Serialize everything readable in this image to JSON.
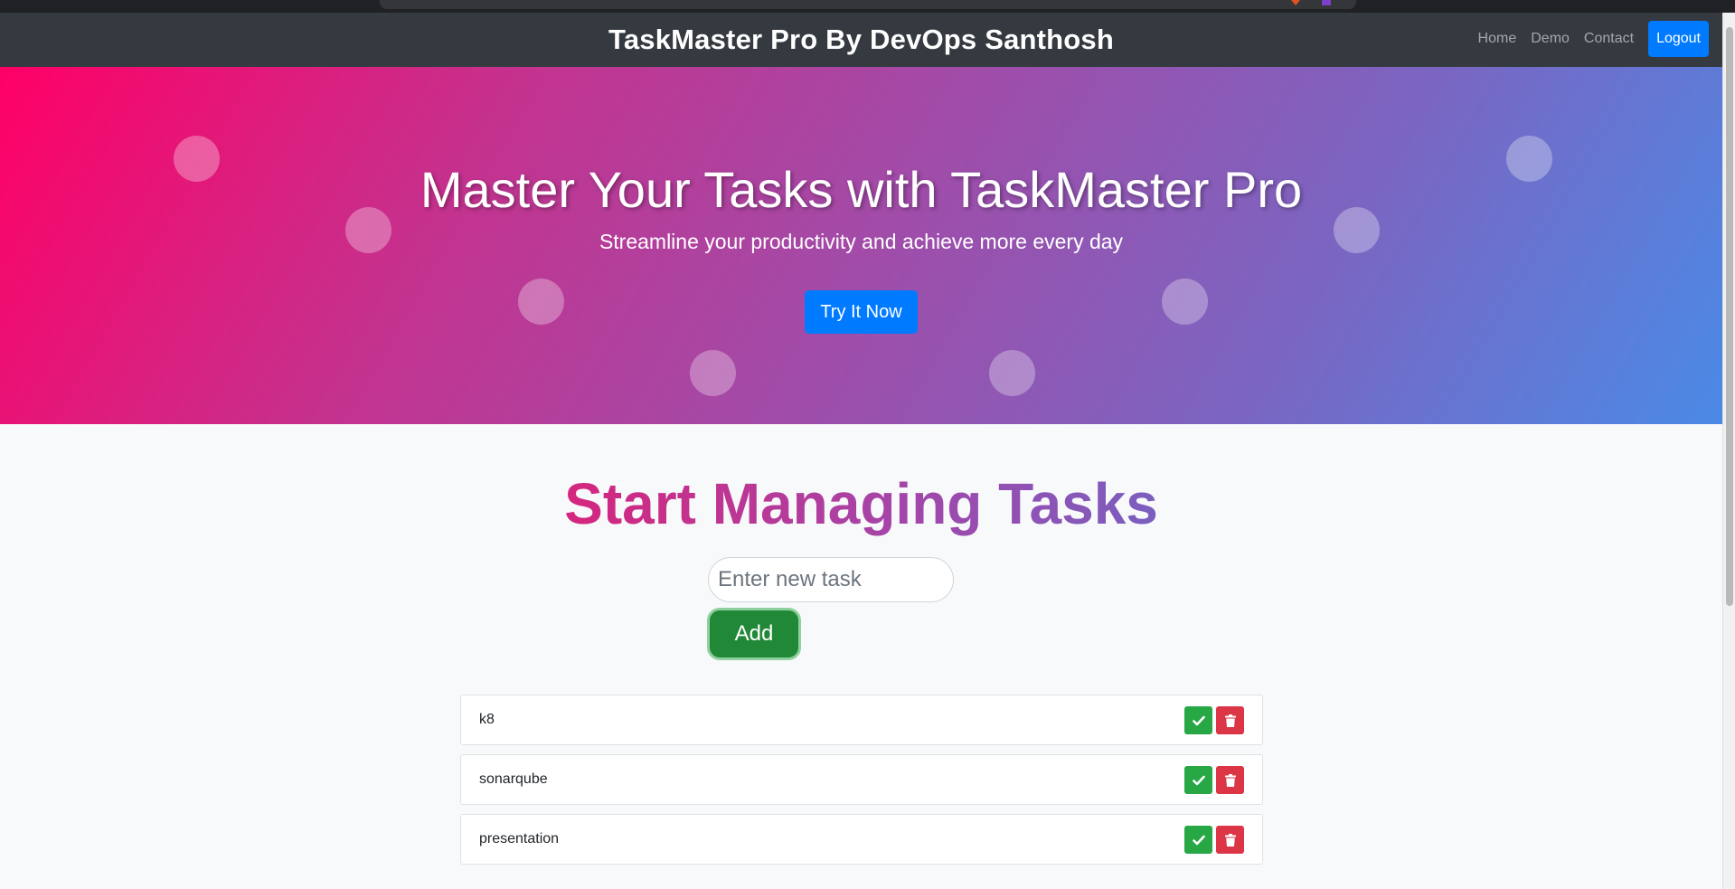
{
  "app": {
    "brand": "TaskMaster Pro By DevOps Santhosh"
  },
  "nav": {
    "links": [
      "Home",
      "Demo",
      "Contact"
    ],
    "logout": "Logout"
  },
  "hero": {
    "title": "Master Your Tasks with TaskMaster Pro",
    "subtitle": "Streamline your productivity and achieve more every day",
    "cta": "Try It Now"
  },
  "main": {
    "title": "Start Managing Tasks",
    "input_placeholder": "Enter new task",
    "add_label": "Add"
  },
  "tasks": [
    {
      "text": "k8"
    },
    {
      "text": "sonarqube"
    },
    {
      "text": "presentation"
    }
  ],
  "icons": {
    "complete": "check-icon",
    "delete": "trash-icon"
  },
  "colors": {
    "navbar": "#343a40",
    "primary": "#007bff",
    "success": "#28a745",
    "danger": "#dc3545"
  }
}
